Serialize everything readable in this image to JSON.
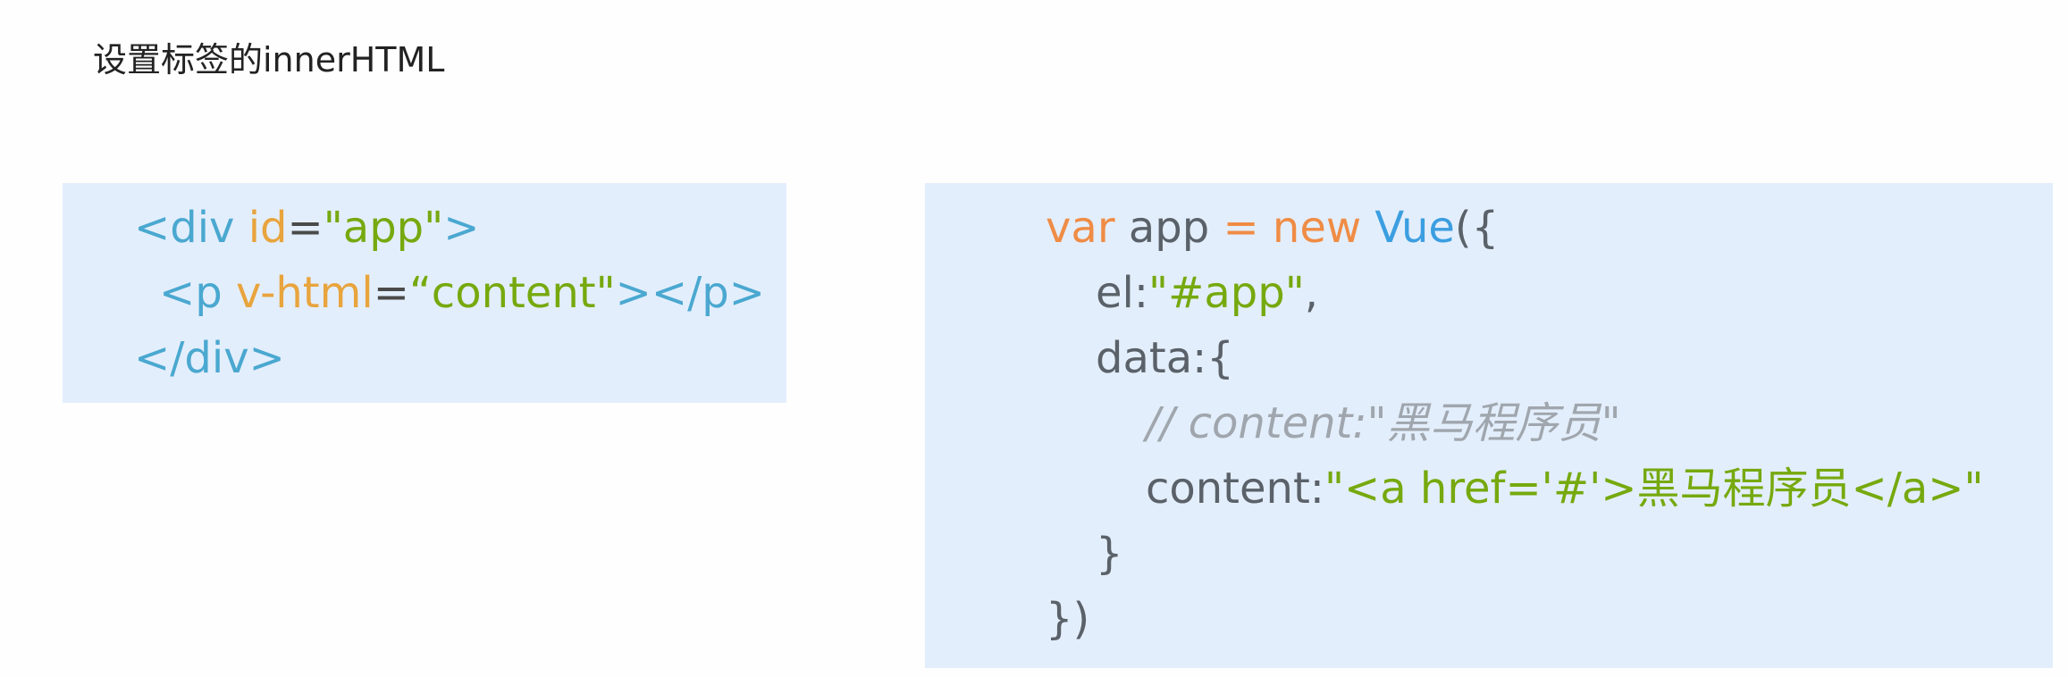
{
  "title": "设置标签的innerHTML",
  "html_code": {
    "line1": {
      "open": "<div",
      "attr": " id",
      "eq": "=",
      "val": "\"app\"",
      "close": ">"
    },
    "line2": {
      "open": "<p",
      "attr": " v-html",
      "eq": "=",
      "val": "“content\"",
      "close": "></p>"
    },
    "line3": {
      "tag": "</div>"
    }
  },
  "js_code": {
    "line1": {
      "kw": "var",
      "name": " app ",
      "op": "=",
      "kw2": " new ",
      "cls": "Vue",
      "punc": "({"
    },
    "line2": {
      "key": "el:",
      "val": "\"#app\"",
      "punc": ","
    },
    "line3": {
      "key": "data:{"
    },
    "line4": {
      "comment": "// content:\"黑马程序员\""
    },
    "line5": {
      "key": "content:",
      "val": "\"<a href='#'>黑马程序员</a>\""
    },
    "line6": {
      "punc": "}"
    },
    "line7": {
      "punc": "})"
    }
  },
  "colors": {
    "tag": "#4aa8d0",
    "attribute": "#e8a43d",
    "string": "#76a90e",
    "keyword": "#ef8c45",
    "class": "#3b9ee0",
    "plain": "#5a6169",
    "comment": "#a0a6ad",
    "box_background": "#e3eefc"
  }
}
